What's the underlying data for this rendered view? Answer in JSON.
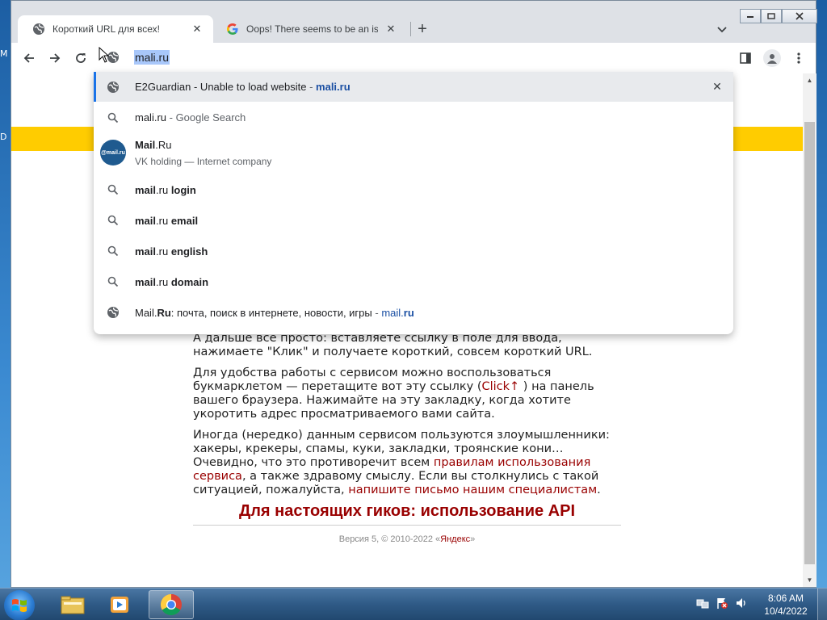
{
  "desktop": {
    "letter_top": "M",
    "letter_mid": "D"
  },
  "tabs": [
    {
      "title": "Короткий URL для всех!",
      "close": "✕"
    },
    {
      "title": "Oops! There seems to be an issue",
      "close": "✕"
    }
  ],
  "new_tab": "+",
  "omnibox": {
    "value": "mali.ru"
  },
  "suggestions": {
    "s1": {
      "title": "E2Guardian - Unable to load website",
      "sep": " - ",
      "url": "mali.ru",
      "remove": "✕"
    },
    "s2": {
      "query": "mali.ru",
      "suffix": " - Google Search"
    },
    "s3": {
      "title_bold": "Mail",
      "title_rest": ".Ru",
      "logo_text": "@mail.ru",
      "subtitle": "VK holding — Internet company"
    },
    "s4": {
      "match": "mail",
      "rest": ".ru ",
      "bold": "login"
    },
    "s5": {
      "match": "mail",
      "rest": ".ru ",
      "bold": "email"
    },
    "s6": {
      "match": "mail",
      "rest": ".ru ",
      "bold": "english"
    },
    "s7": {
      "match": "mail",
      "rest": ".ru ",
      "bold": "domain"
    },
    "s8": {
      "t1": "Mail.",
      "t1b": "Ru",
      "t2": ": почта, поиск в интернете, новости, игры",
      "sep": " - ",
      "url1": "mail.",
      "url2": "ru"
    }
  },
  "content": {
    "p1": "А дальше все просто: вставляете ссылку в поле для ввода, нажимаете \"Клик\" и получаете короткий, совсем короткий URL.",
    "p2_a": "Для удобства работы с сервисом можно воспользоваться букмарклетом — перетащите вот эту ссылку (",
    "p2_link": "Click↑",
    "p2_b": " ) на панель вашего браузера. Нажимайте на эту закладку, когда хотите укоротить адрес просматриваемого вами сайта.",
    "p3_a": "Иногда (нередко) данным сервисом пользуются злоумышленники: хакеры, крекеры, спамы, куки, закладки, троянские кони… Очевидно, что это противоречит всем ",
    "p3_link1": "правилам использования сервиса",
    "p3_b": ", а также здравому смыслу. Если вы столкнулись с такой ситуацией, пожалуйста, ",
    "p3_link2": "напишите письмо нашим специалистам",
    "p3_c": ".",
    "api_heading": "Для настоящих гиков: использование API",
    "footer_a": "Версия 5, © 2010-2022 «",
    "footer_link": "Яндекс",
    "footer_b": "»"
  },
  "clock": {
    "time": "8:06 AM",
    "date": "10/4/2022"
  },
  "colors": {
    "accent": "#1a73e8",
    "banner": "#ffcc00",
    "link": "#990000"
  }
}
